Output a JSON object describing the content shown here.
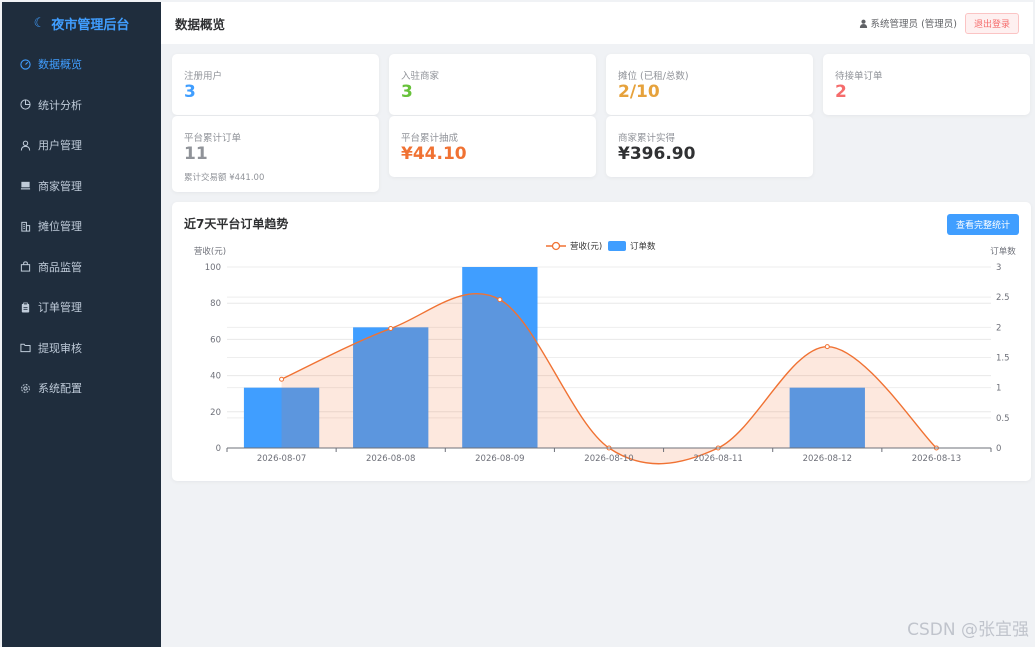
{
  "sidebar": {
    "logo_text": "夜市管理后台",
    "items": [
      {
        "label": "数据概览",
        "icon": "dashboard-icon",
        "active": true
      },
      {
        "label": "统计分析",
        "icon": "pie-chart-icon"
      },
      {
        "label": "用户管理",
        "icon": "user-icon"
      },
      {
        "label": "商家管理",
        "icon": "shop-icon"
      },
      {
        "label": "摊位管理",
        "icon": "building-icon"
      },
      {
        "label": "商品监管",
        "icon": "bag-icon"
      },
      {
        "label": "订单管理",
        "icon": "clipboard-icon"
      },
      {
        "label": "提现审核",
        "icon": "folder-icon"
      },
      {
        "label": "系统配置",
        "icon": "gear-icon"
      }
    ]
  },
  "header": {
    "title": "数据概览",
    "user": "系统管理员 (管理员)",
    "logout": "退出登录"
  },
  "stats": [
    {
      "label": "注册用户",
      "value": "3",
      "color": "#409eff"
    },
    {
      "label": "入驻商家",
      "value": "3",
      "color": "#67c23a"
    },
    {
      "label": "摊位 (已租/总数)",
      "value": "2/10",
      "color": "#e6a23c"
    },
    {
      "label": "待接单订单",
      "value": "2",
      "color": "#f56c6c"
    },
    {
      "label": "平台累计订单",
      "value": "11",
      "color": "#909399",
      "sub": "累计交易额 ¥441.00"
    },
    {
      "label": "平台累计抽成",
      "value": "¥44.10",
      "color": "#f07233"
    },
    {
      "label": "商家累计实得",
      "value": "¥396.90",
      "color": "#303133"
    }
  ],
  "chart_card": {
    "title": "近7天平台订单趋势",
    "button": "查看完整统计"
  },
  "chart_data": {
    "type": "bar",
    "categories": [
      "2026-08-07",
      "2026-08-08",
      "2026-08-09",
      "2026-08-10",
      "2026-08-11",
      "2026-08-12",
      "2026-08-13"
    ],
    "series": [
      {
        "name": "营收(元)",
        "type": "line",
        "axis": "left",
        "color": "#f07233",
        "smooth": true,
        "area": true,
        "values": [
          38,
          66,
          82,
          0,
          0,
          56,
          0
        ]
      },
      {
        "name": "订单数",
        "type": "bar",
        "axis": "right",
        "color": "#409eff",
        "values": [
          1,
          2,
          3,
          0,
          0,
          1,
          0
        ]
      }
    ],
    "ylabel": "营收(元)",
    "ylim": [
      0,
      100
    ],
    "yticks": [
      0,
      20,
      40,
      60,
      80,
      100
    ],
    "y2label": "订单数",
    "y2lim": [
      0,
      3
    ],
    "y2ticks": [
      0,
      0.5,
      1,
      1.5,
      2,
      2.5,
      3
    ],
    "legend_position": "top-center",
    "grid": true
  },
  "watermark": "CSDN @张宜强"
}
